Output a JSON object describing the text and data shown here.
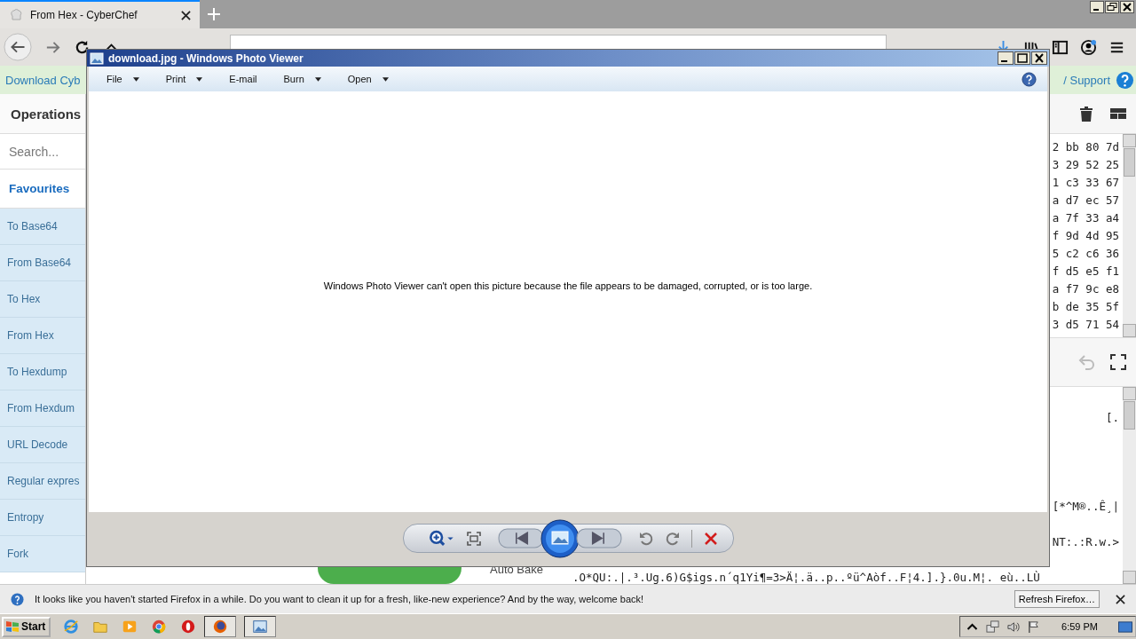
{
  "browser": {
    "tabs": [
      {
        "title": "From Hex - CyberChef",
        "selected": true
      }
    ]
  },
  "cyberchef": {
    "banner_left": "Download Cyb",
    "banner_right": "/ Support",
    "operations_title": "Operations",
    "search": {
      "placeholder": "Search..."
    },
    "favourites_heading": "Favourites",
    "operations": [
      "To Base64",
      "From Base64",
      "To Hex",
      "From Hex",
      "To Hexdump",
      "From Hexdum",
      "URL Decode",
      "Regular expres",
      "Entropy",
      "Fork"
    ],
    "input_lines": [
      "2 bb 80 7d",
      "3 29 52 25",
      "1 c3 33 67",
      "a d7 ec 57",
      "a 7f 33 a4",
      "f 9d 4d 95",
      "5 c2 c6 36",
      "f d5 e5 f1",
      "a f7 9c e8",
      "b de 35 5f",
      "3 d5 71 54"
    ],
    "output_lines": [
      "[.",
      "[*^M®..Ê¸|",
      "NT:.:R.w.>",
      ".O*QU:.|.³.Ug.6)G$igs.n´q1Yi¶=3>Ä¦.ä..p..ºü^Aòf..F¦4.].}.0u.M¦. eù..LÙ"
    ],
    "auto_bake_label": "Auto Bake"
  },
  "photo_viewer": {
    "title": "download.jpg - Windows Photo Viewer",
    "menu": [
      {
        "label": "File",
        "dropdown": true
      },
      {
        "label": "Print",
        "dropdown": true
      },
      {
        "label": "E-mail",
        "dropdown": false
      },
      {
        "label": "Burn",
        "dropdown": true
      },
      {
        "label": "Open",
        "dropdown": true
      }
    ],
    "message": "Windows Photo Viewer can't open this picture because the file appears to be damaged, corrupted, or is too large."
  },
  "notification": {
    "text": "It looks like you haven't started Firefox in a while. Do you want to clean it up for a fresh, like-new experience? And by the way, welcome back!",
    "button": "Refresh Firefox…"
  },
  "taskbar": {
    "start": "Start",
    "clock": "6:59 PM"
  }
}
